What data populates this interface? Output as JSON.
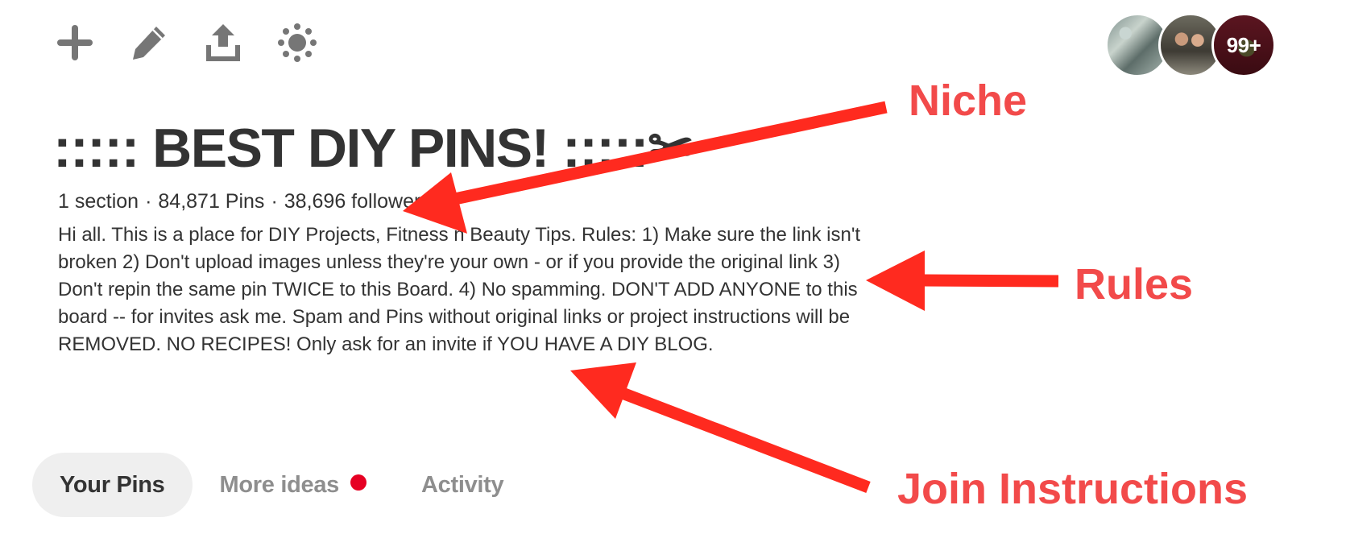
{
  "toolbar": {
    "add_icon": "plus-icon",
    "edit_icon": "pencil-icon",
    "share_icon": "share-upload-icon",
    "more_icon": "gear-sun-icon"
  },
  "collaborators": {
    "overflow_count": "99+"
  },
  "board": {
    "title": "::::: BEST DIY PINS! :::::✂",
    "stats": {
      "sections": "1 section",
      "pins": "84,871 Pins",
      "followers": "38,696 followers",
      "separator": "·"
    },
    "description": "Hi all. This is a place for DIY Projects, Fitness n Beauty Tips. Rules: 1) Make sure the link isn't broken 2) Don't upload images unless they're your own - or if you provide the original link 3) Don't repin the same pin TWICE to this Board. 4) No spamming. DON'T ADD ANYONE to this board -- for invites ask me. Spam and Pins without original links or project instructions will be REMOVED. NO RECIPES! Only ask for an invite if YOU HAVE A DIY BLOG."
  },
  "tabs": [
    {
      "label": "Your Pins",
      "active": true
    },
    {
      "label": "More ideas",
      "active": false,
      "has_notification": true
    },
    {
      "label": "Activity",
      "active": false
    }
  ],
  "annotations": {
    "niche": "Niche",
    "rules": "Rules",
    "join": "Join Instructions",
    "color": "#f24a4a",
    "arrow_color": "#ff2a1f"
  },
  "colors": {
    "text": "#333333",
    "muted": "#8e8e8e",
    "active_tab_bg": "#efefef",
    "notification": "#e60023"
  }
}
